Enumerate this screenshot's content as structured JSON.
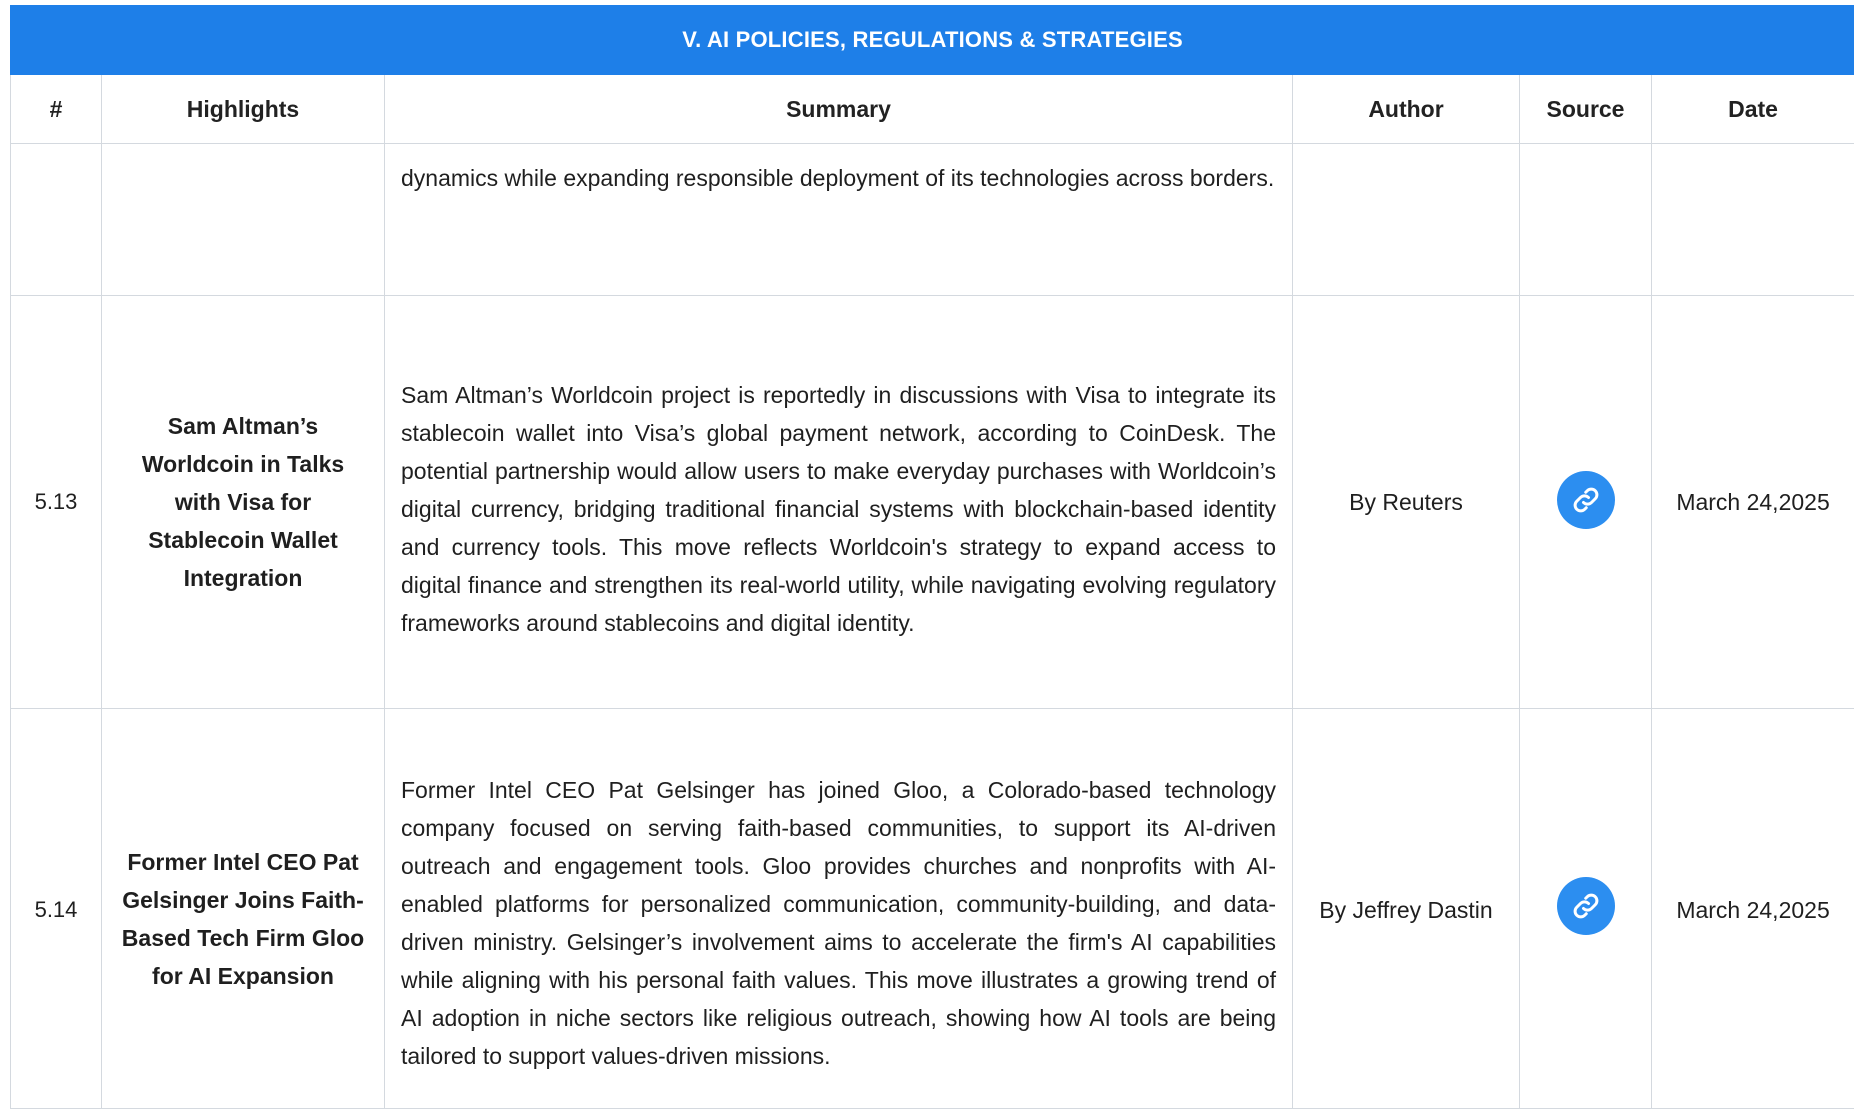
{
  "section_title": "V. AI POLICIES, REGULATIONS & STRATEGIES",
  "headers": {
    "num": "#",
    "highlights": "Highlights",
    "summary": "Summary",
    "author": "Author",
    "source": "Source",
    "date": "Date"
  },
  "continued_row": {
    "summary": "dynamics while expanding responsible deployment of its technologies across borders."
  },
  "rows": [
    {
      "num": "5.13",
      "highlight": "Sam Altman’s Worldcoin in Talks with Visa for Stablecoin Wallet Integration",
      "summary": "Sam Altman’s Worldcoin project is reportedly in discussions with Visa to integrate its stablecoin wallet into Visa’s global payment network, according to CoinDesk. The potential partnership would allow users to make everyday purchases with Worldcoin’s digital currency, bridging traditional financial systems with blockchain-based identity and currency tools. This move reflects Worldcoin's strategy to expand access to digital finance and strengthen its real-world utility, while navigating evolving regulatory frameworks around stablecoins and digital identity.",
      "author": "By Reuters",
      "source_icon": "link-icon",
      "date": "March 24,2025"
    },
    {
      "num": "5.14",
      "highlight": "Former Intel CEO Pat Gelsinger Joins Faith-Based Tech Firm Gloo for AI Expansion",
      "summary": "Former Intel CEO Pat Gelsinger has joined Gloo, a Colorado-based technology company focused on serving faith-based communities, to support its AI-driven outreach and engagement tools. Gloo provides churches and nonprofits with AI-enabled platforms for personalized communication, community-building, and data-driven ministry. Gelsinger’s involvement aims to accelerate the firm's AI capabilities while aligning with his personal faith values. This move illustrates a growing trend of AI adoption in niche sectors like religious outreach, showing how AI tools are being tailored to support values-driven missions.",
      "author": "By Jeffrey Dastin",
      "source_icon": "link-icon",
      "date": "March 24,2025"
    }
  ],
  "colors": {
    "header_blue": "#1e7fe8",
    "link_button": "#2c8ef0",
    "grid_line": "#d4d9df"
  }
}
